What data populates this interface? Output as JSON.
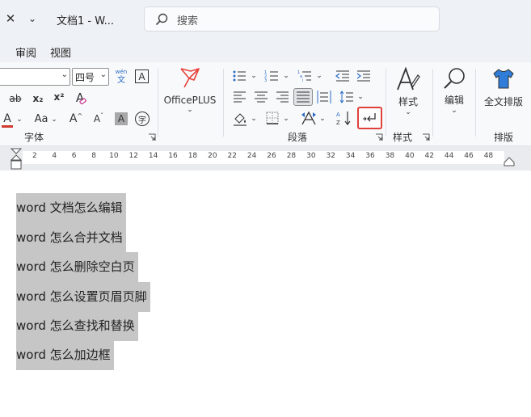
{
  "title_bar": {
    "close_glyph": "✕",
    "caret_glyph": "⌄",
    "doc_title": "文档1  -  W...",
    "search_placeholder": "搜索"
  },
  "menu": {
    "tabs": [
      "审阅",
      "视图"
    ]
  },
  "ribbon": {
    "font": {
      "font_name": "",
      "font_size": "四号",
      "pinyin_top": "wén",
      "pinyin_bottom": "文",
      "border_char": "A",
      "strike_label": "ab",
      "sub_label": "x₂",
      "sup_label": "x²",
      "clear_format_label": "A",
      "font_color_label": "A",
      "font_color_bar": "#d03a2f",
      "change_case_label": "Aa",
      "grow_label": "A",
      "shrink_label": "A",
      "shade_label": "A",
      "enclose_label": "字",
      "group_label": "字体"
    },
    "officeplus": {
      "label": "OfficePLUS",
      "brand_color": "#e8413b"
    },
    "paragraph": {
      "group_label": "段落",
      "show_marks_highlight": "#e0403b"
    },
    "styles": {
      "label": "样式",
      "group_label": "样式"
    },
    "editing": {
      "label": "编辑"
    },
    "layout": {
      "label": "全文排版",
      "group_label": "排版",
      "shirt_color": "#2f7dd8"
    }
  },
  "ruler": {
    "numbers": [
      "2",
      "4",
      "6",
      "8",
      "10",
      "12",
      "14",
      "16",
      "18",
      "20",
      "22",
      "24",
      "26",
      "28",
      "30",
      "32",
      "34",
      "36",
      "38",
      "40",
      "42",
      "44",
      "46",
      "48"
    ]
  },
  "document": {
    "lines": [
      "word 文档怎么编辑",
      "word 怎么合并文档",
      "word 怎么删除空白页",
      "word 怎么设置页眉页脚",
      "word 怎么查找和替换",
      "word 怎么加边框"
    ],
    "selection_color": "#c6c6c6"
  }
}
